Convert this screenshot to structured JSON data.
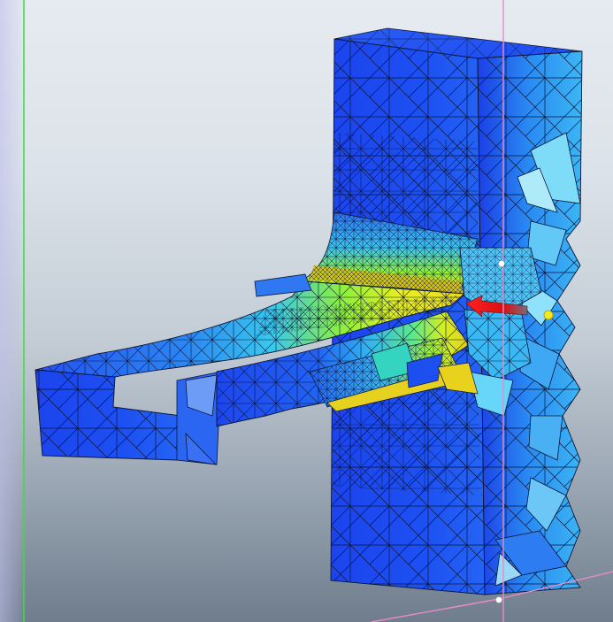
{
  "viewport": {
    "label": "",
    "background_top": "#e6ebf0",
    "background_bottom": "#6f7d8c"
  },
  "model": {
    "kind": "fea-mesh-stress-plot",
    "colormap": [
      "#1a3cf0",
      "#2f74f2",
      "#33c6f0",
      "#3ef2b0",
      "#8ff03a",
      "#e8f021",
      "#f0b21e"
    ],
    "mesh_line_color": "#0b1435",
    "load_arrow_color": "#e01010",
    "bounding_box_color": "#e88bc8",
    "axis_line_color": "#3ddc3d",
    "marker_yellow": "#f5e81c",
    "marker_white": "#ffffff"
  },
  "icons": {
    "load_arrow": "red-arrow-icon",
    "control_point_active": "yellow-dot-icon",
    "control_point": "white-dot-icon"
  }
}
